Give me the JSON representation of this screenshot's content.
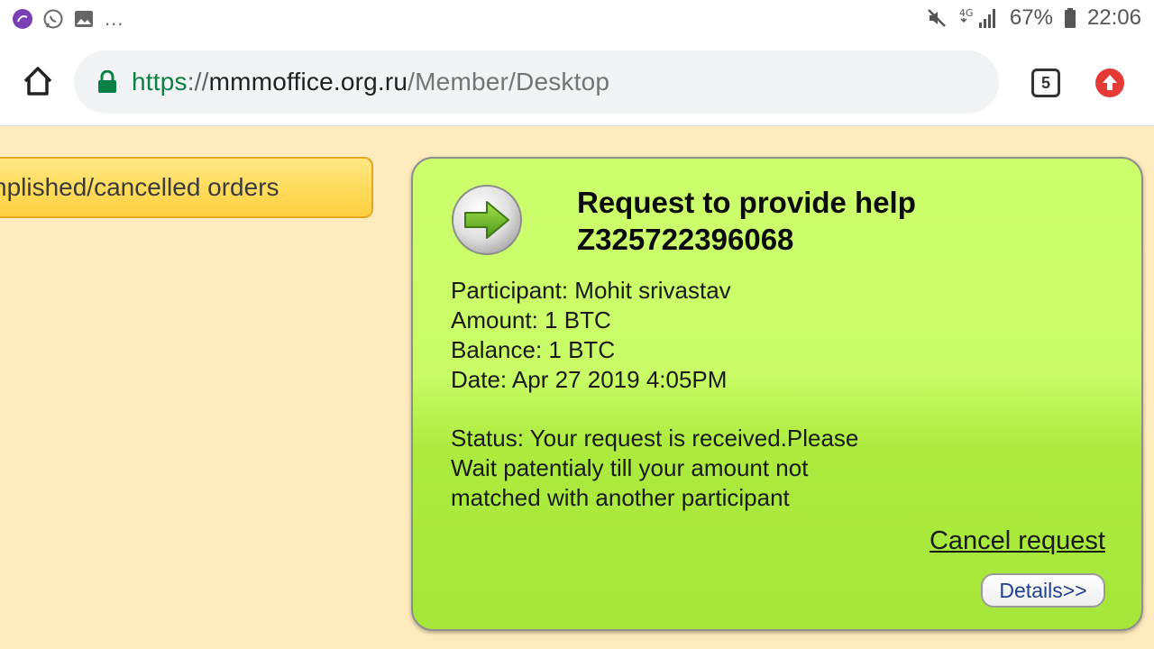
{
  "statusbar": {
    "battery": "67%",
    "time": "22:06",
    "network": "4G",
    "overflow": "..."
  },
  "browser": {
    "url_scheme": "https",
    "url_sep": "://",
    "url_host": "mmmoffice.org.ru",
    "url_path": "/Member/Desktop",
    "tab_count": "5"
  },
  "page": {
    "orders_tab_label": "nplished/cancelled orders",
    "card": {
      "title_line1": "Request to provide help",
      "title_line2": "Z325722396068",
      "participant": "Participant: Mohit srivastav",
      "amount": "Amount: 1 BTC",
      "balance": "Balance: 1 BTC",
      "date": "Date: Apr 27 2019 4:05PM",
      "status_line1": "Status: Your request is received.Please",
      "status_line2": "Wait patentialy till your amount not",
      "status_line3": "matched with another participant",
      "cancel_label": "Cancel request",
      "details_label": "Details>>"
    }
  },
  "colors": {
    "page_bg": "#fdebbd",
    "card_bg_top": "#ccff6c",
    "card_bg_bottom": "#a6e63a",
    "orders_tab_bg": "#ffdc5e",
    "url_scheme": "#0b8043"
  },
  "icons": [
    "app-icon",
    "whatsapp-icon",
    "gallery-icon",
    "mute-icon",
    "signal-icon",
    "battery-icon",
    "home-icon",
    "lock-icon",
    "tabs-icon",
    "update-icon",
    "arrow-right-icon"
  ]
}
